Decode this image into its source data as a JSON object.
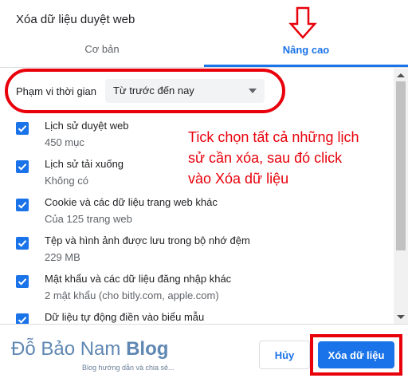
{
  "dialog": {
    "title": "Xóa dữ liệu duyệt web",
    "tabs": [
      {
        "label": "Cơ bản",
        "active": false
      },
      {
        "label": "Nâng cao",
        "active": true
      }
    ]
  },
  "time_range": {
    "label": "Phạm vi thời gian",
    "selected": "Từ trước đến nay"
  },
  "items": [
    {
      "title": "Lịch sử duyệt web",
      "subtitle": "450 mục",
      "checked": true
    },
    {
      "title": "Lịch sử tải xuống",
      "subtitle": "Không có",
      "checked": true
    },
    {
      "title": "Cookie và các dữ liệu trang web khác",
      "subtitle": "Của 125 trang web",
      "checked": true
    },
    {
      "title": "Tệp và hình ảnh được lưu trong bộ nhớ đệm",
      "subtitle": "229 MB",
      "checked": true
    },
    {
      "title": "Mật khẩu và các dữ liệu đăng nhập khác",
      "subtitle": "2 mật khẩu (cho bitly.com, apple.com)",
      "checked": true
    },
    {
      "title": "Dữ liệu tự động điền vào biểu mẫu",
      "subtitle": "",
      "checked": true
    }
  ],
  "annotation": {
    "line1": "Tick chọn tất cả những lịch",
    "line2": "sử cần xóa, sau đó click",
    "line3": "vào Xóa dữ liệu"
  },
  "watermark": {
    "name": "Đỗ Bảo Nam",
    "blog": "Blog",
    "tagline": "Blog hướng dẫn và chia sẻ..."
  },
  "footer": {
    "cancel_label": "Hủy",
    "clear_label": "Xóa dữ liệu"
  },
  "colors": {
    "accent": "#1a73e8",
    "annotation_red": "#e8000b"
  },
  "icons": {
    "checkbox": "check-icon",
    "dropdown": "caret-down-icon",
    "pointer": "arrow-down-icon"
  }
}
